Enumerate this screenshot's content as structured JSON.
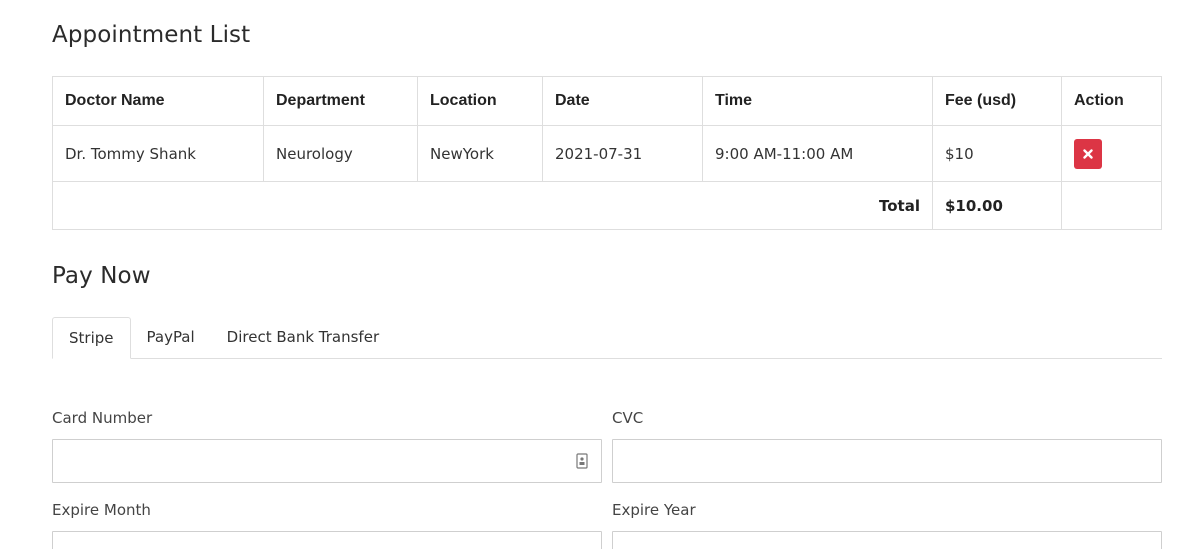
{
  "appointment": {
    "title": "Appointment List",
    "columns": [
      "Doctor Name",
      "Department",
      "Location",
      "Date",
      "Time",
      "Fee (usd)",
      "Action"
    ],
    "rows": [
      {
        "doctor": "Dr. Tommy Shank",
        "department": "Neurology",
        "location": "NewYork",
        "date": "2021-07-31",
        "time": "9:00 AM-11:00 AM",
        "fee": "$10",
        "action_icon": "close-icon"
      }
    ],
    "total_label": "Total",
    "total_value": "$10.00"
  },
  "payment": {
    "title": "Pay Now",
    "tabs": [
      {
        "label": "Stripe",
        "active": true
      },
      {
        "label": "PayPal",
        "active": false
      },
      {
        "label": "Direct Bank Transfer",
        "active": false
      }
    ],
    "fields": {
      "card_number": {
        "label": "Card Number",
        "value": "",
        "icon": "card-autofill-icon"
      },
      "cvc": {
        "label": "CVC",
        "value": ""
      },
      "expire_month": {
        "label": "Expire Month",
        "value": ""
      },
      "expire_year": {
        "label": "Expire Year",
        "value": ""
      }
    }
  },
  "colors": {
    "danger": "#dc3545",
    "border": "#dedede"
  }
}
